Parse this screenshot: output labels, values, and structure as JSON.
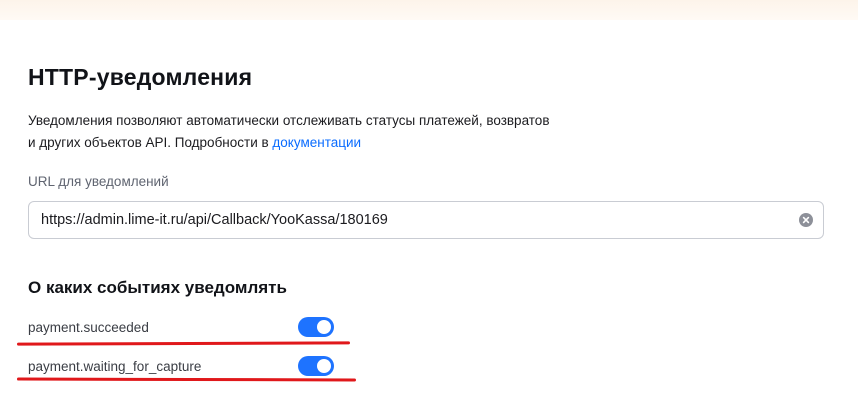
{
  "section": {
    "title": "HTTP-уведомления",
    "description_line1": "Уведомления позволяют автоматически отслеживать статусы платежей, возвратов",
    "description_line2_prefix": "и других объектов API. Подробности в ",
    "docs_link": "документации"
  },
  "url_field": {
    "label": "URL для уведомлений",
    "value": "https://admin.lime-it.ru/api/Callback/YooKassa/180169",
    "clear_icon": "clear-circle-icon"
  },
  "events": {
    "title": "О каких событиях уведомлять",
    "items": [
      {
        "label": "payment.succeeded",
        "enabled": true
      },
      {
        "label": "payment.waiting_for_capture",
        "enabled": true
      }
    ]
  },
  "colors": {
    "accent": "#1e73ff",
    "link": "#0a6cff",
    "annotation_underline": "#e0181b"
  }
}
